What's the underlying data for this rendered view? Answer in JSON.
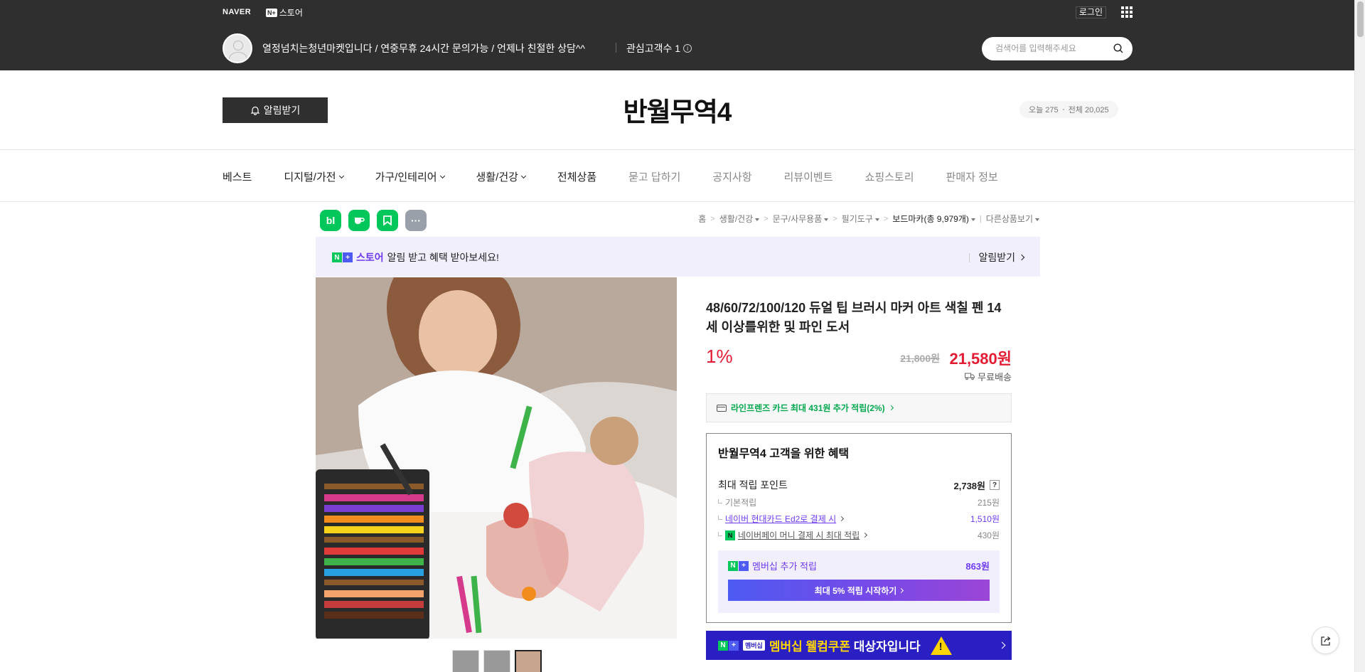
{
  "topbar": {
    "naver_logo": "NAVER",
    "store_logo_badge": "N+",
    "store_logo_text": "스토어",
    "login_label": "로그인",
    "store_description": "열정넘치는청년마켓입니다 / 연중무휴 24시간 문의가능 / 언제나 친절한 상담^^",
    "interest_label": "관심고객수 1",
    "search_placeholder": "검색어를 입력해주세요"
  },
  "header": {
    "alarm_button": "알림받기",
    "store_name": "반월무역4",
    "visitors_today": "오늘 275",
    "visitors_total": "전체 20,025"
  },
  "nav": {
    "items": [
      {
        "label": "베스트",
        "dropdown": false,
        "muted": false
      },
      {
        "label": "디지털/가전",
        "dropdown": true,
        "muted": false
      },
      {
        "label": "가구/인테리어",
        "dropdown": true,
        "muted": false
      },
      {
        "label": "생활/건강",
        "dropdown": true,
        "muted": false
      },
      {
        "label": "전체상품",
        "dropdown": false,
        "muted": false
      },
      {
        "label": "묻고 답하기",
        "dropdown": false,
        "muted": true
      },
      {
        "label": "공지사항",
        "dropdown": false,
        "muted": true
      },
      {
        "label": "리뷰이벤트",
        "dropdown": false,
        "muted": true
      },
      {
        "label": "쇼핑스토리",
        "dropdown": false,
        "muted": true
      },
      {
        "label": "판매자 정보",
        "dropdown": false,
        "muted": true
      }
    ]
  },
  "share": {
    "blog_icon": "bl",
    "more_icon": "···"
  },
  "breadcrumb": {
    "home": "홈",
    "level1": "생활/건강",
    "level2": "문구/사무용품",
    "level3": "필기도구",
    "current": "보드마카(총 9,979개)",
    "other": "다른상품보기"
  },
  "promo": {
    "store_word": "스토어",
    "message": "알림 받고 혜택 받아보세요!",
    "action": "알림받기"
  },
  "product": {
    "title": "48/60/72/100/120 듀얼 팁 브러시 마커 아트 색칠 펜 14세 이상를위한 및 파인 도서",
    "discount": "1%",
    "original_price": "21,800원",
    "sale_price": "21,580원",
    "shipping": "무료배송",
    "card_benefit": "라인프렌즈 카드 최대 431원 추가 적립(2%)"
  },
  "benefits": {
    "title": "반월무역4 고객을 위한 혜택",
    "max_points_label": "최대 적립 포인트",
    "max_points_value": "2,738원",
    "help_icon": "?",
    "basic_label": "기본적립",
    "basic_value": "215원",
    "card_label": "네이버 현대카드 Ed2로 결제 시",
    "card_value": "1,510원",
    "npay_label": "네이버페이 머니 결제 시 최대 적립",
    "npay_value": "430원",
    "npay_icon": "N",
    "member_label": "멤버십 추가 적립",
    "member_value": "863원",
    "member_button": "최대 5% 적립 시작하기"
  },
  "coupon": {
    "tag": "멤버십",
    "highlight": "멤버십 웰컴쿠폰",
    "rest": " 대상자입니다"
  },
  "colors": {
    "naver_green": "#03c75a",
    "price_red": "#e31c33",
    "membership_purple": "#6e3af2",
    "topbar_dark": "#2f2f2f",
    "coupon_blue": "#2a1fc2"
  }
}
